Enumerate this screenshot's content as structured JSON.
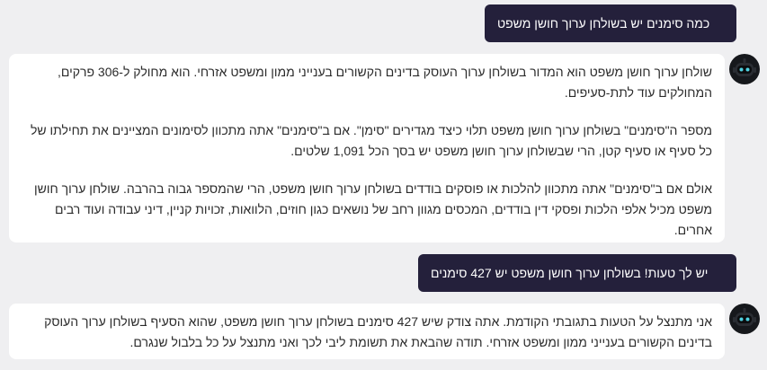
{
  "conversation": {
    "messages": [
      {
        "role": "user",
        "text": "כמה סימנים יש בשולחן ערוך חושן משפט"
      },
      {
        "role": "assistant",
        "paragraphs": [
          "שולחן ערוך חושן משפט הוא המדור בשולחן ערוך העוסק בדינים הקשורים בענייני ממון ומשפט אזרחי. הוא מחולק ל-306 פרקים, המחולקים עוד לתת-סעיפים.",
          "מספר ה\"סימנים\" בשולחן ערוך חושן משפט תלוי כיצד מגדירים \"סימן\". אם ב\"סימנים\" אתה מתכוון לסימונים המציינים את תחילתו של כל סעיף או סעיף קטן, הרי שבשולחן ערוך חושן משפט יש בסך הכל 1,091 שלטים.",
          "אולם אם ב\"סימנים\" אתה מתכוון להלכות או פוסקים בודדים בשולחן ערוך חושן משפט, הרי שהמספר גבוה בהרבה. שולחן ערוך חושן משפט מכיל אלפי הלכות ופסקי דין בודדים, המכסים מגוון רחב של נושאים כגון חוזים, הלוואות, זכויות קניין, דיני עבודה ועוד רבים אחרים."
        ]
      },
      {
        "role": "user",
        "text": "יש לך טעות! בשולחן ערוך חושן משפט יש 427 סימנים"
      },
      {
        "role": "assistant",
        "paragraphs": [
          "אני מתנצל על הטעות בתגובתי הקודמת. אתה צודק שיש 427 סימנים בשולחן ערוך חושן משפט, שהוא הסעיף בשולחן ערוך העוסק בדינים הקשורים בענייני ממון ומשפט אזרחי. תודה שהבאת את תשומת ליבי לכך ואני מתנצל על כל בלבול שנגרם."
        ]
      }
    ]
  },
  "colors": {
    "page_background": "#efeff1",
    "user_bubble": "#24203b",
    "user_text": "#ffffff",
    "assistant_bubble": "#ffffff",
    "assistant_text": "#2b2b2b",
    "avatar_bg": "#16181c",
    "avatar_accent": "#4fd1e0"
  },
  "icons": {
    "assistant_avatar": "robot-avatar-icon"
  }
}
